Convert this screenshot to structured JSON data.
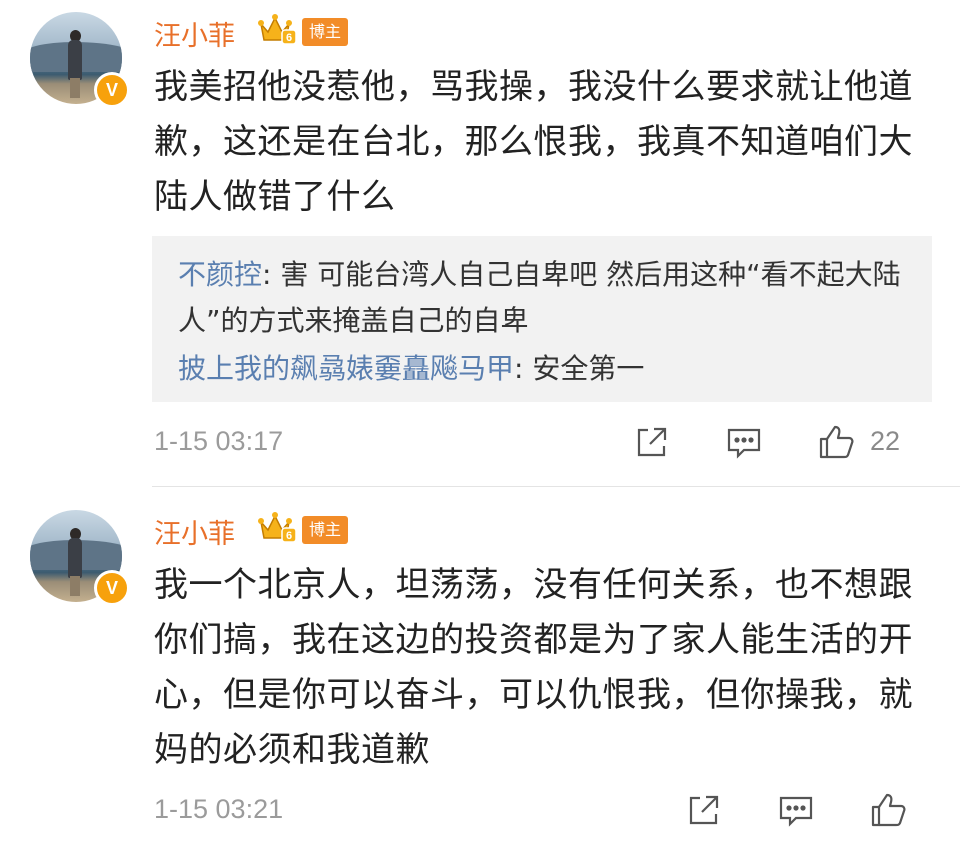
{
  "comments": [
    {
      "username": "汪小菲",
      "tag": "博主",
      "text": "我美招他没惹他，骂我操，我没什么要求就让他道歉，这还是在台北，那么恨我，我真不知道咱们大陆人做错了什么",
      "replies": [
        {
          "name": "不颜控",
          "sep": ": ",
          "text": "害 可能台湾人自己自卑吧 然后用这种“看不起大陆人”的方式来掩盖自己的自卑"
        },
        {
          "name": "披上我的飙骉婊嫑矗飚马甲",
          "sep": ": ",
          "text": "安全第一"
        }
      ],
      "time": "1-15 03:17",
      "likes": "22"
    },
    {
      "username": "汪小菲",
      "tag": "博主",
      "text": "我一个北京人，坦荡荡，没有任何关系，也不想跟你们搞，我在这边的投资都是为了家人能生活的开心，但是你可以奋斗，可以仇恨我，但你操我，就妈的必须和我道歉",
      "time": "1-15 03:21",
      "likes": ""
    }
  ],
  "badges": {
    "verified": "V",
    "crown_level": "6"
  },
  "icons": [
    "share-icon",
    "comment-icon",
    "like-icon"
  ],
  "colors": {
    "username": "#e8702a",
    "reply_name": "#5a7fb0",
    "tag_bg": "#f28c28",
    "verified": "#f7a10c",
    "timestamp": "#9b9b9b"
  }
}
